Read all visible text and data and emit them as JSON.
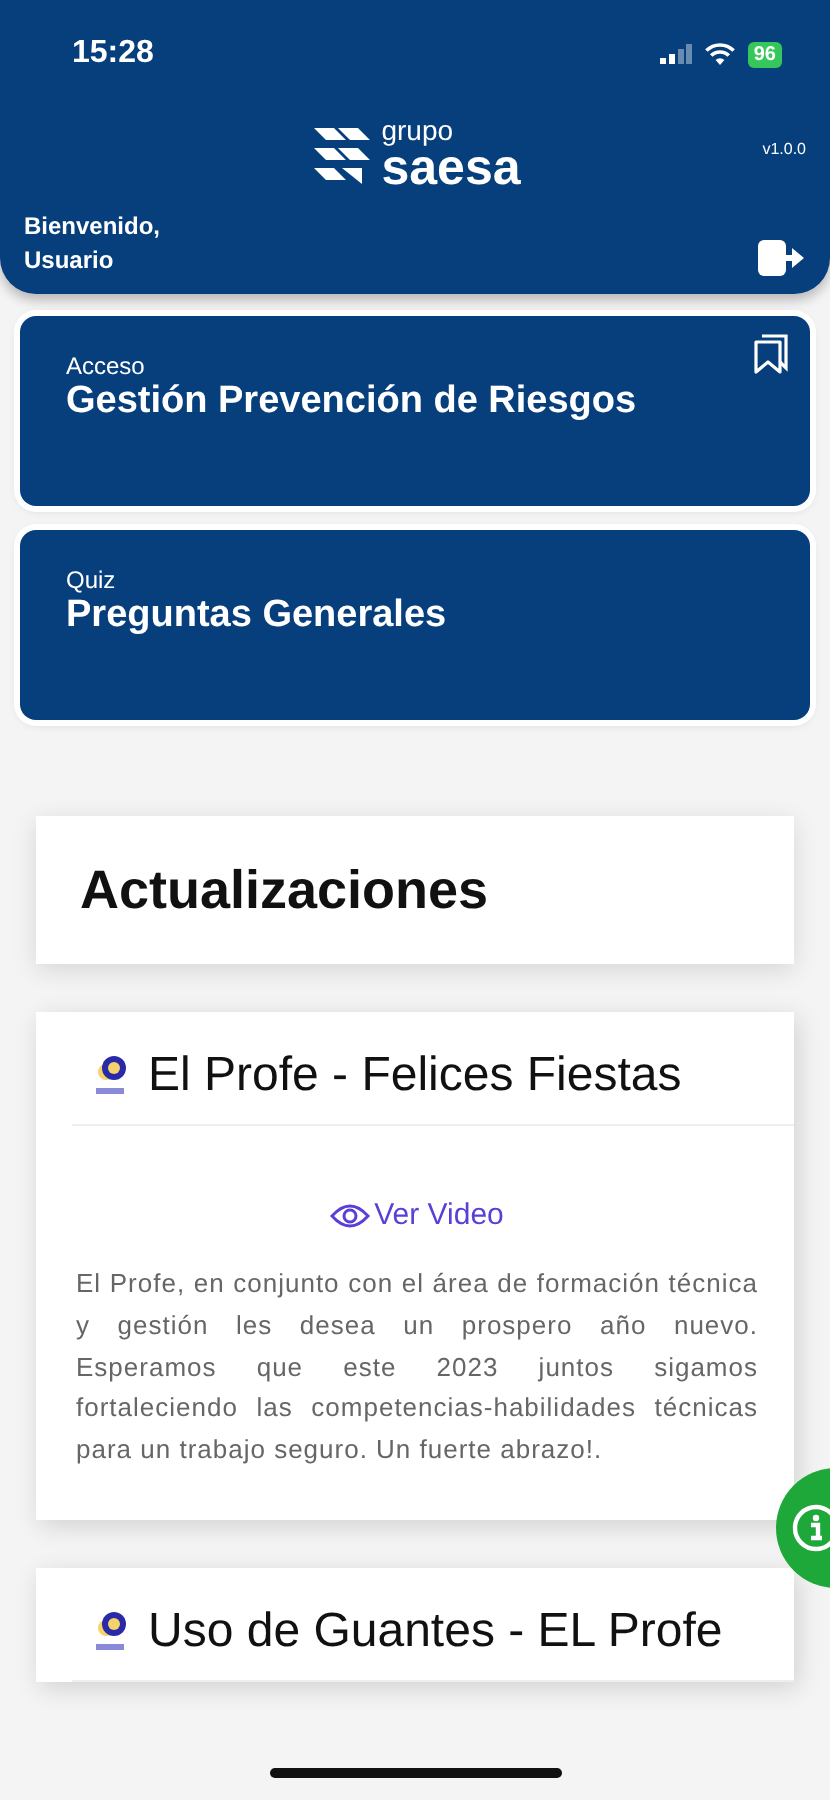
{
  "status_bar": {
    "time": "15:28",
    "battery": "96"
  },
  "header": {
    "logo_small": "grupo",
    "logo_large": "saesa",
    "version": "v1.0.0",
    "greeting": "Bienvenido,\nUsuario"
  },
  "menu_cards": [
    {
      "label": "Acceso",
      "title": "Gestión Prevención de Riesgos",
      "bookmark": true
    },
    {
      "label": "Quiz",
      "title": "Preguntas Generales",
      "bookmark": false
    }
  ],
  "section_title": "Actualizaciones",
  "posts": [
    {
      "title": "El Profe - Felices Fiestas",
      "link": "Ver Video",
      "body": "El Profe, en conjunto con el área de formación técnica y gestión les desea un prospero año nuevo. Esperamos que este 2023 juntos sigamos fortaleciendo las competencias-habilidades técnicas para un trabajo seguro. Un fuerte abrazo!."
    },
    {
      "title": "Uso de Guantes - EL Profe"
    }
  ]
}
